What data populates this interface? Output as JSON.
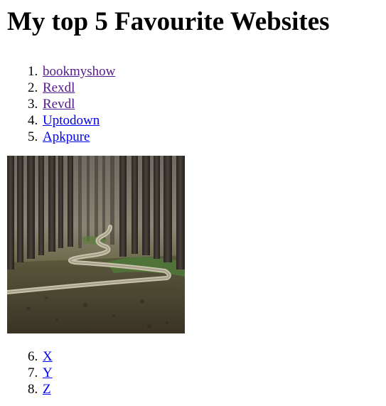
{
  "page": {
    "title": "My top 5 Favourite Websites"
  },
  "list_top": [
    {
      "num": "1.",
      "label": "bookmyshow",
      "visited": true
    },
    {
      "num": "2.",
      "label": "Rexdl",
      "visited": true
    },
    {
      "num": "3.",
      "label": "Revdl",
      "visited": true
    },
    {
      "num": "4.",
      "label": "Uptodown",
      "visited": false
    },
    {
      "num": "5.",
      "label": "Apkpure",
      "visited": false
    }
  ],
  "image": {
    "subject": "forest-path-photo"
  },
  "list_bottom": [
    {
      "num": "6.",
      "label": "X",
      "visited": false
    },
    {
      "num": "7.",
      "label": "Y",
      "visited": false
    },
    {
      "num": "8.",
      "label": "Z",
      "visited": false
    }
  ],
  "colors": {
    "link": "#0000ee",
    "visited_link": "#551a8b",
    "text": "#000000",
    "background": "#ffffff"
  }
}
